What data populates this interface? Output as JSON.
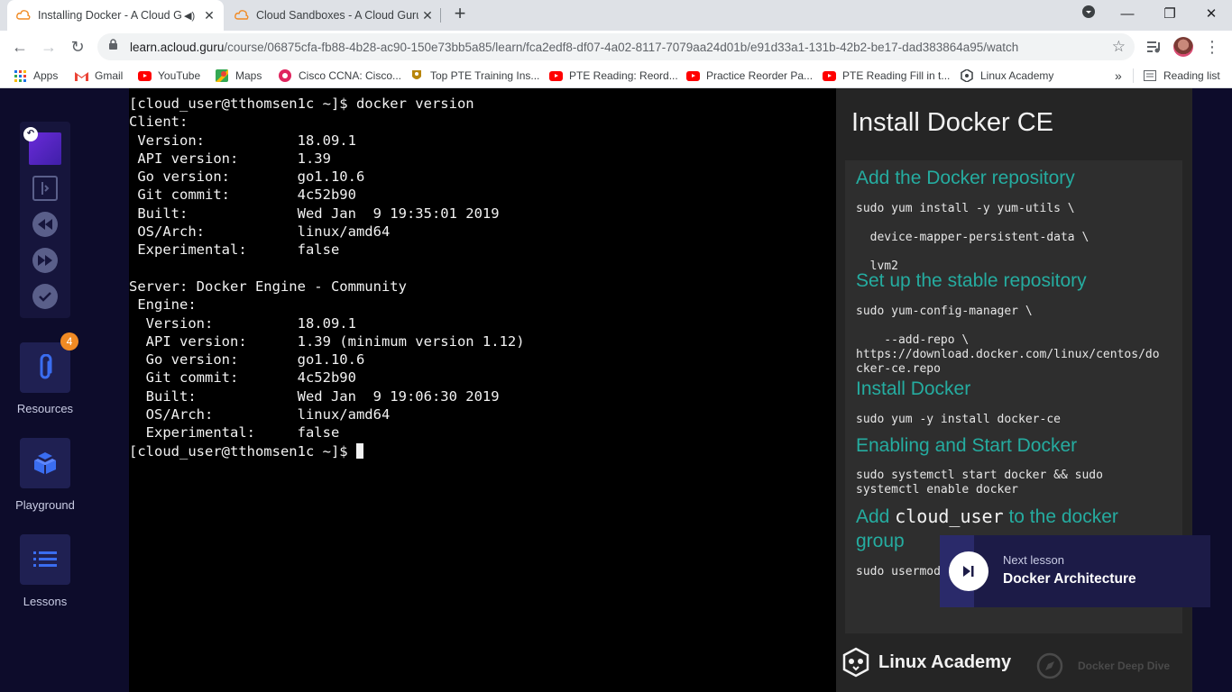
{
  "browser": {
    "tabs": [
      {
        "title": "Installing Docker - A Cloud G",
        "active": true,
        "audio": true
      },
      {
        "title": "Cloud Sandboxes - A Cloud Guru",
        "active": false
      }
    ],
    "url_host": "learn.acloud.guru",
    "url_path": "/course/06875cfa-fb88-4b28-ac90-150e73bb5a85/learn/fca2edf8-df07-4a02-8117-7079aa24d01b/e91d33a1-131b-42b2-be17-dad383864a95/watch",
    "bookmarks": [
      {
        "label": "Apps",
        "icon": "apps-grid-icon"
      },
      {
        "label": "Gmail",
        "icon": "gmail-icon"
      },
      {
        "label": "YouTube",
        "icon": "youtube-icon"
      },
      {
        "label": "Maps",
        "icon": "maps-icon"
      },
      {
        "label": "Cisco CCNA: Cisco...",
        "icon": "cisco-icon"
      },
      {
        "label": "Top PTE Training Ins...",
        "icon": "pte-icon"
      },
      {
        "label": "PTE Reading: Reord...",
        "icon": "youtube-icon"
      },
      {
        "label": "Practice Reorder Pa...",
        "icon": "youtube-icon"
      },
      {
        "label": "PTE Reading Fill in t...",
        "icon": "youtube-icon"
      },
      {
        "label": "Linux Academy",
        "icon": "linux-academy-icon"
      }
    ],
    "more_bookmarks": "»",
    "reading_list": "Reading list"
  },
  "sidebar": {
    "resources_badge": "4",
    "resources_label": "Resources",
    "playground_label": "Playground",
    "lessons_label": "Lessons"
  },
  "terminal": {
    "lines": [
      "[cloud_user@tthomsen1c ~]$ docker version",
      "Client:",
      " Version:           18.09.1",
      " API version:       1.39",
      " Go version:        go1.10.6",
      " Git commit:        4c52b90",
      " Built:             Wed Jan  9 19:35:01 2019",
      " OS/Arch:           linux/amd64",
      " Experimental:      false",
      "",
      "Server: Docker Engine - Community",
      " Engine:",
      "  Version:          18.09.1",
      "  API version:      1.39 (minimum version 1.12)",
      "  Go version:       go1.10.6",
      "  Git commit:       4c52b90",
      "  Built:            Wed Jan  9 19:06:30 2019",
      "  OS/Arch:          linux/amd64",
      "  Experimental:     false"
    ],
    "prompt": "[cloud_user@tthomsen1c ~]$ "
  },
  "slide": {
    "title": "Install Docker CE",
    "h1": "Add the Docker repository",
    "c1": "sudo yum install -y yum-utils \\\n\n  device-mapper-persistent-data \\\n\n  lvm2",
    "h2": "Set up the stable repository",
    "c2": "sudo yum-config-manager \\\n\n    --add-repo \\\nhttps://download.docker.com/linux/centos/do\ncker-ce.repo",
    "h3": "Install Docker",
    "c3": "sudo yum -y install docker-ce",
    "h4": "Enabling and Start Docker",
    "c4": "sudo systemctl start docker && sudo\nsystemctl enable docker",
    "h5_pre": "Add ",
    "h5_code": "cloud_user",
    "h5_post": " to the docker",
    "h5_line2": "group",
    "c5": "sudo usermod",
    "brand": "Linux Academy",
    "course": "Docker Deep Dive"
  },
  "next_lesson": {
    "label": "Next lesson",
    "title": "Docker Architecture"
  },
  "colors": {
    "accent_teal": "#25aca0",
    "badge_orange": "#f08a24",
    "page_bg": "#0d0c2b"
  }
}
